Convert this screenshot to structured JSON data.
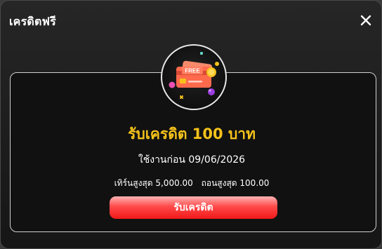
{
  "modal": {
    "title": "เครดิตฟรี",
    "close_icon": "close-icon"
  },
  "badge": {
    "illustration": "credit-card-icon",
    "card_text": "FREE"
  },
  "offer": {
    "headline": "รับเครดิต 100 บาท",
    "use_before": "ใช้งานก่อน 09/06/2026",
    "max_turnover": "เทิร์นสูงสุด 5,000.00",
    "max_withdraw": "ถอนสูงสุด 100.00"
  },
  "actions": {
    "claim_label": "รับเครดิต"
  },
  "colors": {
    "headline": "#f5c21b",
    "button": "#f01818",
    "card_illustration": "#ff6a4d"
  }
}
